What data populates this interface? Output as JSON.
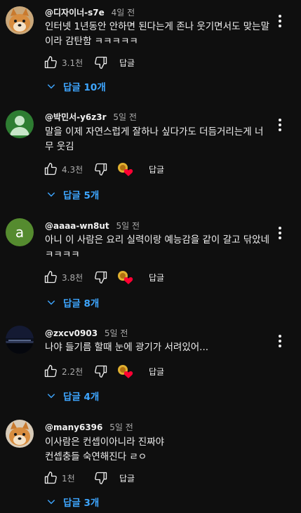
{
  "comments": [
    {
      "author": "@디자이너-s7e",
      "time": "4일 전",
      "text": "인터넷 1년동안 안하면 된다는게 존나 웃기면서도 맞는말이라 감탄함 ㅋㅋㅋㅋㅋ",
      "likes": "3.1천",
      "reply_label": "답글",
      "replies_label": "답글 10개",
      "avatar": "shiba-dog",
      "creator_heart": false
    },
    {
      "author": "@박민서-y6z3r",
      "time": "5일 전",
      "text": "말을 이제 자연스럽게 잘하나 싶다가도 더듬거리는게 너무 웃김",
      "likes": "4.3천",
      "reply_label": "답글",
      "replies_label": "답글 5개",
      "avatar": "default-person",
      "creator_heart": true
    },
    {
      "author": "@aaaa-wn8ut",
      "time": "5일 전",
      "text": "아니 이 사람은 요리 실력이랑 예능감을 같이 갈고 닦았네ㅋㅋㅋㅋ",
      "likes": "3.8천",
      "reply_label": "답글",
      "replies_label": "답글 8개",
      "avatar": "letter",
      "avatar_letter": "a",
      "creator_heart": true
    },
    {
      "author": "@zxcv0903",
      "time": "5일 전",
      "text": "나야 들기름 할때 눈에 광기가 서려있어...",
      "likes": "2.2천",
      "reply_label": "답글",
      "replies_label": "답글 4개",
      "avatar": "night-city",
      "creator_heart": true
    },
    {
      "author": "@many6396",
      "time": "5일 전",
      "text": "이사람은 컨셉이아니라 진짜야\n컨셉충들 숙연해진다 ㄹㅇ",
      "likes": "1천",
      "reply_label": "답글",
      "replies_label": "답글 3개",
      "avatar": "shiba-dog",
      "creator_heart": false
    }
  ],
  "colors": {
    "background": "#0f0f0f",
    "link": "#3ea6ff",
    "secondary_text": "#aaaaaa",
    "heart": "#ff0033",
    "avatar_green": "#2e7d32",
    "avatar_letter_green": "#558b2f"
  }
}
